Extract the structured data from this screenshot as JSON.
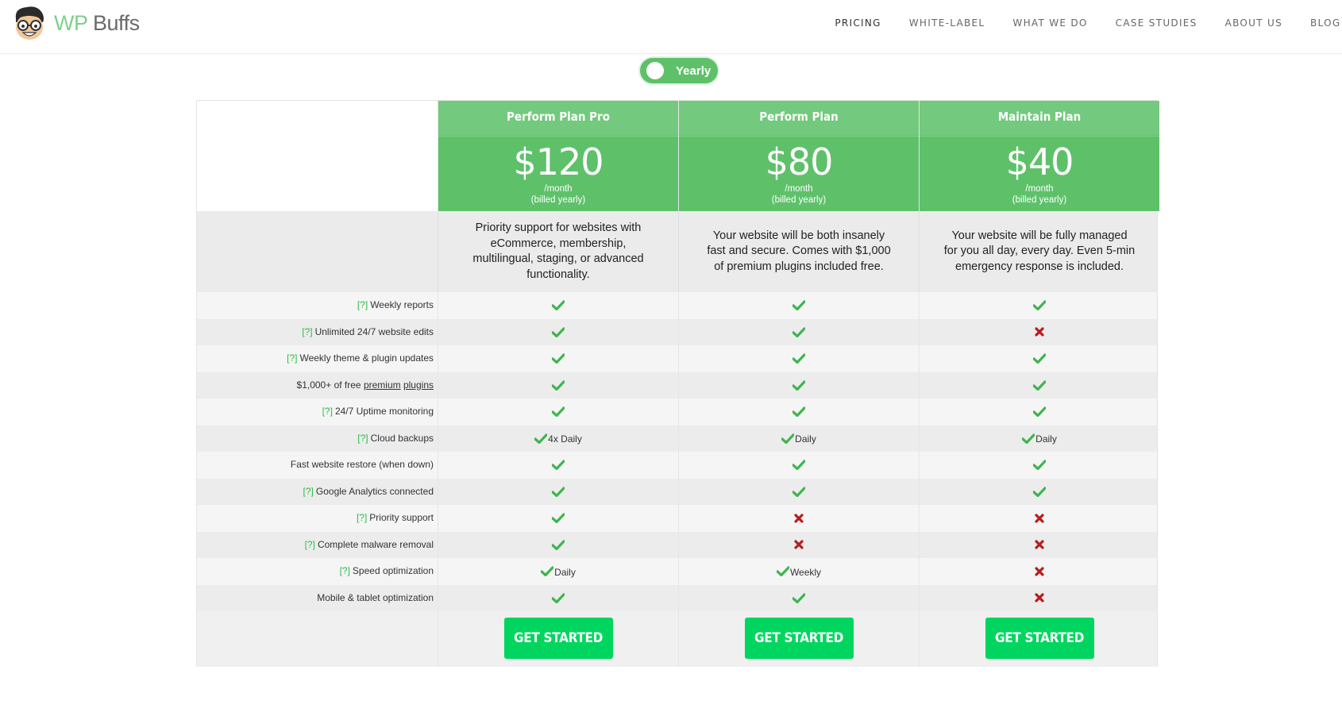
{
  "brand": {
    "wp": "WP",
    "buffs": "Buffs"
  },
  "nav": [
    {
      "label": "PRICING"
    },
    {
      "label": "WHITE-LABEL"
    },
    {
      "label": "WHAT WE DO"
    },
    {
      "label": "CASE STUDIES"
    },
    {
      "label": "ABOUT US"
    },
    {
      "label": "BLOG"
    }
  ],
  "toggle": {
    "label": "Yearly"
  },
  "plans": [
    {
      "name": "Perform Plan Pro",
      "price": "$120",
      "per": "/month",
      "billing": "(billed yearly)",
      "description": "Priority support for websites with eCommerce, membership, multilingual, staging, or advanced functionality.",
      "cta": "GET STARTED"
    },
    {
      "name": "Perform Plan",
      "price": "$80",
      "per": "/month",
      "billing": "(billed yearly)",
      "description": "Your website will be both insanely fast and secure. Comes with $1,000 of premium plugins included free.",
      "cta": "GET STARTED"
    },
    {
      "name": "Maintain Plan",
      "price": "$40",
      "per": "/month",
      "billing": "(billed yearly)",
      "description": "Your website will be fully managed for you all day, every day. Even 5-min emergency response is included.",
      "cta": "GET STARTED"
    }
  ],
  "features": [
    {
      "q": "[?]",
      "label": "Weekly reports",
      "values": [
        {
          "icon": "check",
          "text": ""
        },
        {
          "icon": "check",
          "text": ""
        },
        {
          "icon": "check",
          "text": ""
        }
      ]
    },
    {
      "q": "[?]",
      "label": "Unlimited 24/7 website edits",
      "values": [
        {
          "icon": "check",
          "text": ""
        },
        {
          "icon": "check",
          "text": ""
        },
        {
          "icon": "cross",
          "text": ""
        }
      ]
    },
    {
      "q": "[?]",
      "label": "Weekly theme & plugin updates",
      "values": [
        {
          "icon": "check",
          "text": ""
        },
        {
          "icon": "check",
          "text": ""
        },
        {
          "icon": "check",
          "text": ""
        }
      ]
    },
    {
      "q": "",
      "label": "$1,000+ of free ",
      "link1": "premium",
      "link2": "plugins",
      "values": [
        {
          "icon": "check",
          "text": ""
        },
        {
          "icon": "check",
          "text": ""
        },
        {
          "icon": "check",
          "text": ""
        }
      ]
    },
    {
      "q": "[?]",
      "label": "24/7 Uptime monitoring",
      "values": [
        {
          "icon": "check",
          "text": ""
        },
        {
          "icon": "check",
          "text": ""
        },
        {
          "icon": "check",
          "text": ""
        }
      ]
    },
    {
      "q": "[?]",
      "label": "Cloud backups",
      "values": [
        {
          "icon": "check",
          "text": "4x Daily"
        },
        {
          "icon": "check",
          "text": "Daily"
        },
        {
          "icon": "check",
          "text": "Daily"
        }
      ]
    },
    {
      "q": "",
      "label": "Fast website restore (when down)",
      "values": [
        {
          "icon": "check",
          "text": ""
        },
        {
          "icon": "check",
          "text": ""
        },
        {
          "icon": "check",
          "text": ""
        }
      ]
    },
    {
      "q": "[?]",
      "label": "Google Analytics connected",
      "values": [
        {
          "icon": "check",
          "text": ""
        },
        {
          "icon": "check",
          "text": ""
        },
        {
          "icon": "check",
          "text": ""
        }
      ]
    },
    {
      "q": "[?]",
      "label": "Priority support",
      "values": [
        {
          "icon": "check",
          "text": ""
        },
        {
          "icon": "cross",
          "text": ""
        },
        {
          "icon": "cross",
          "text": ""
        }
      ]
    },
    {
      "q": "[?]",
      "label": "Complete malware removal",
      "values": [
        {
          "icon": "check",
          "text": ""
        },
        {
          "icon": "cross",
          "text": ""
        },
        {
          "icon": "cross",
          "text": ""
        }
      ]
    },
    {
      "q": "[?]",
      "label": "Speed optimization",
      "values": [
        {
          "icon": "check",
          "text": "Daily"
        },
        {
          "icon": "check",
          "text": "Weekly"
        },
        {
          "icon": "cross",
          "text": ""
        }
      ]
    },
    {
      "q": "",
      "label": "Mobile & tablet optimization",
      "values": [
        {
          "icon": "check",
          "text": ""
        },
        {
          "icon": "check",
          "text": ""
        },
        {
          "icon": "cross",
          "text": ""
        }
      ]
    }
  ],
  "colors": {
    "accent": "#5ec16a",
    "check": "#3fb54f",
    "cross": "#b71c1c",
    "cta": "#00d65f"
  }
}
